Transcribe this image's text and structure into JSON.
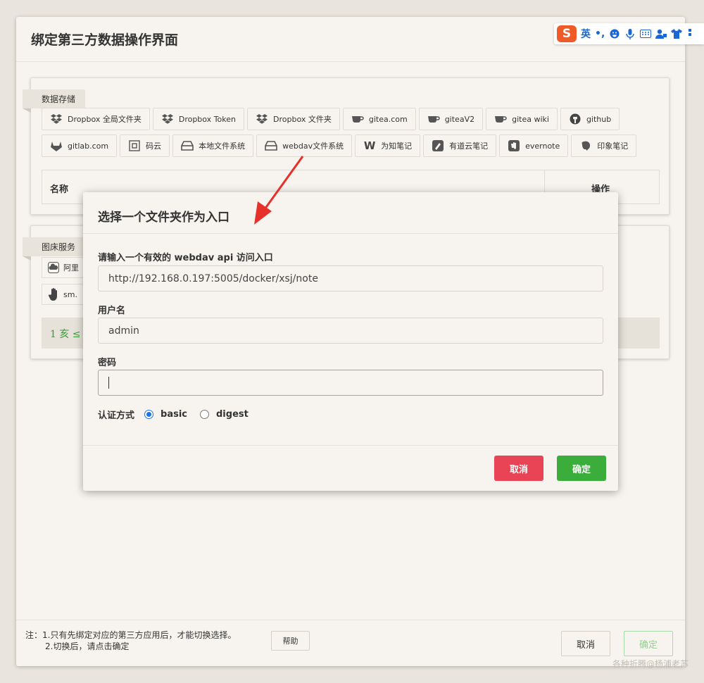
{
  "window": {
    "title": "绑定第三方数据操作界面"
  },
  "data_storage": {
    "label": "数据存储",
    "row1": [
      {
        "label": "Dropbox 全局文件夹",
        "icon": "dropbox-icon"
      },
      {
        "label": "Dropbox Token",
        "icon": "dropbox-icon"
      },
      {
        "label": "Dropbox 文件夹",
        "icon": "dropbox-icon"
      },
      {
        "label": "gitea.com",
        "icon": "gitea-icon"
      },
      {
        "label": "giteaV2",
        "icon": "gitea-icon"
      },
      {
        "label": "gitea wiki",
        "icon": "gitea-icon"
      },
      {
        "label": "github",
        "icon": "github-icon"
      }
    ],
    "row2": [
      {
        "label": "gitlab.com",
        "icon": "gitlab-icon"
      },
      {
        "label": "码云",
        "icon": "gitee-icon"
      },
      {
        "label": "本地文件系统",
        "icon": "drive-icon"
      },
      {
        "label": "webdav文件系统",
        "icon": "drive-icon"
      },
      {
        "label": "为知笔记",
        "icon": "wiz-icon"
      },
      {
        "label": "有道云笔记",
        "icon": "youdao-icon"
      },
      {
        "label": "evernote",
        "icon": "evernote-icon"
      },
      {
        "label": "印象笔记",
        "icon": "elephant-icon"
      }
    ],
    "table": {
      "col_name": "名称",
      "col_action": "操作"
    }
  },
  "image_host": {
    "label": "图床服务",
    "items": [
      {
        "label": "阿里",
        "icon": "cloud-icon"
      },
      {
        "label": "sm.",
        "icon": "hand-icon"
      }
    ],
    "status": "1 亥 ≤"
  },
  "footer": {
    "note_line1": "注：1.只有先绑定对应的第三方应用后，才能切换选择。",
    "note_line2": "2.切换后，请点击确定",
    "help": "帮助",
    "cancel": "取消",
    "ok": "确定",
    "watermark": "各种折腾@杨浦老苏"
  },
  "ime_toolbar": {
    "mode": "英",
    "punct": "•,"
  },
  "modal": {
    "title": "选择一个文件夹作为入口",
    "url_label": "请输入一个有效的 webdav api 访问入口",
    "url_value": "http://192.168.0.197:5005/docker/xsj/note",
    "user_label": "用户名",
    "user_value": "admin",
    "pass_label": "密码",
    "pass_value": "",
    "auth_label": "认证方式",
    "auth_options": [
      "basic",
      "digest"
    ],
    "auth_selected": "basic",
    "cancel": "取消",
    "ok": "确定"
  },
  "colors": {
    "danger": "#e84455",
    "success": "#3aad3a",
    "annotation_arrow": "#e8302a",
    "ime_brand": "#ef5a26"
  }
}
